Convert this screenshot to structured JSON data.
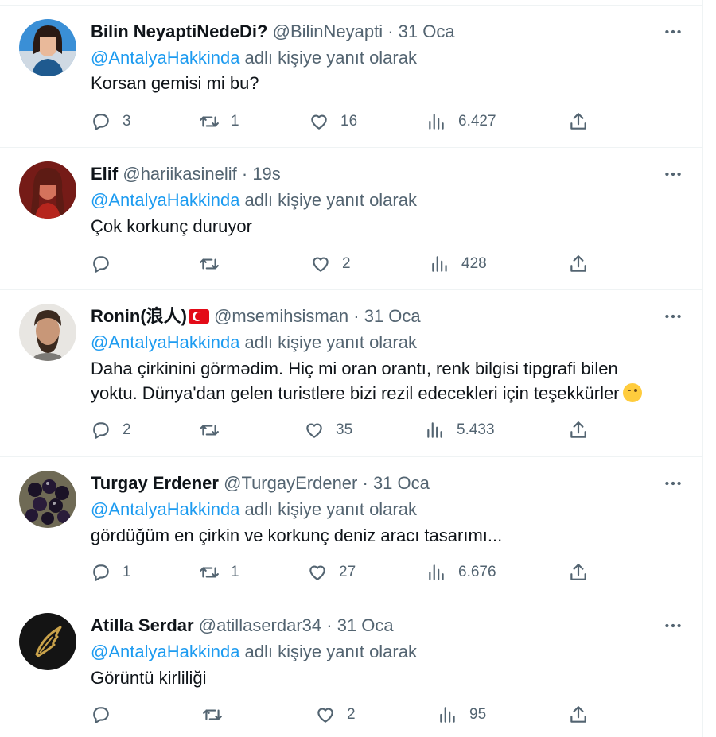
{
  "tweets": [
    {
      "name": "Bilin NeyaptiNedeDi?",
      "handle": "@BilinNeyapti",
      "time": "31 Oca",
      "reply_prefix": "",
      "mention": "@AntalyaHakkinda",
      "reply_suffix": " adlı kişiye yanıt olarak",
      "text_lines": [
        "Korsan gemisi mi bu?"
      ],
      "replies": "3",
      "retweets": "1",
      "likes": "16",
      "views": "6.427"
    },
    {
      "name": "Elif",
      "handle": "@hariikasinelif",
      "time": "19s",
      "mention": "@AntalyaHakkinda",
      "reply_suffix": " adlı kişiye yanıt olarak",
      "text_lines": [
        "Çok korkunç duruyor"
      ],
      "replies": "",
      "retweets": "",
      "likes": "2",
      "views": "428"
    },
    {
      "name": "Ronin(浪人)",
      "handle": "@msemihsisman",
      "time": "31 Oca",
      "mention": "@AntalyaHakkinda",
      "reply_suffix": " adlı kişiye yanıt olarak",
      "text_lines": [
        "Daha çirkinini görmədim. Hiç mi oran orantı, renk bilgisi tipgrafi bilen",
        "yoktu. Dünya'dan gelen turistlere bizi rezil edecekleri için teşekkürler"
      ],
      "replies": "2",
      "retweets": "",
      "likes": "35",
      "views": "5.433"
    },
    {
      "name": "Turgay Erdener",
      "handle": "@TurgayErdener",
      "time": "31 Oca",
      "mention": "@AntalyaHakkinda",
      "reply_suffix": " adlı kişiye yanıt olarak",
      "text_lines": [
        "gördüğüm en çirkin ve korkunç deniz aracı tasarımı..."
      ],
      "replies": "1",
      "retweets": "1",
      "likes": "27",
      "views": "6.676"
    },
    {
      "name": "Atilla Serdar",
      "handle": "@atillaserdar34",
      "time": "31 Oca",
      "mention": "@AntalyaHakkinda",
      "reply_suffix": " adlı kişiye yanıt olarak",
      "text_lines": [
        "Görüntü kirliliği"
      ],
      "replies": "",
      "retweets": "",
      "likes": "2",
      "views": "95"
    }
  ],
  "separator": " · ",
  "colors": {
    "link": "#1d9bf0",
    "muted": "#536471",
    "text": "#0f1419",
    "divider": "#eff3f4"
  },
  "icons": [
    "reply-icon",
    "retweet-icon",
    "like-icon",
    "views-icon",
    "share-icon",
    "more-icon",
    "turkey-flag-icon",
    "winking-face-emoji"
  ]
}
